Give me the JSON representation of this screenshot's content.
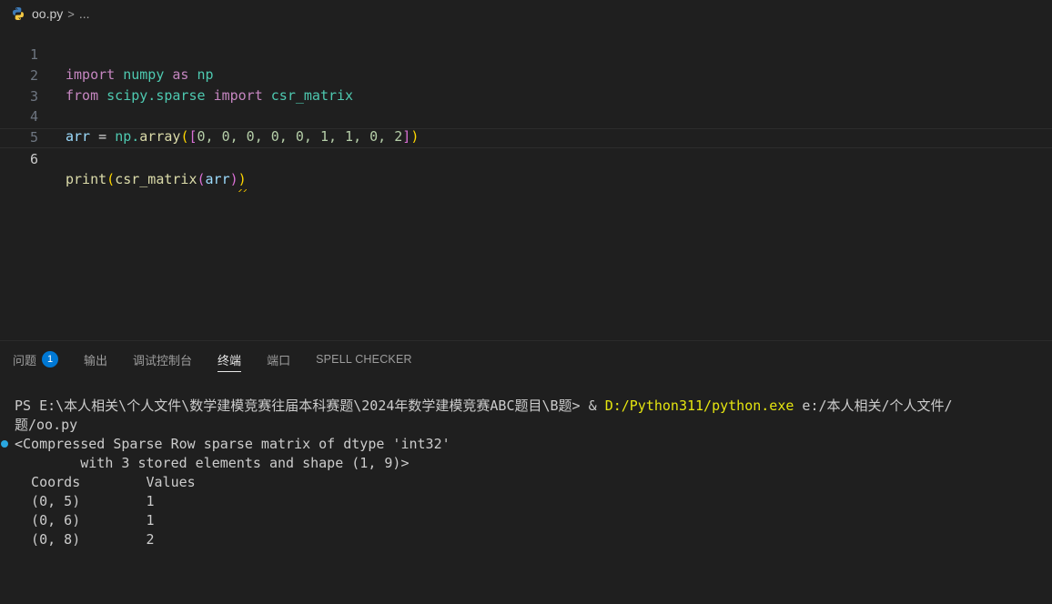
{
  "breadcrumb": {
    "file": "oo.py",
    "separator": ">",
    "more": "..."
  },
  "editor": {
    "line_numbers": [
      "1",
      "2",
      "3",
      "4",
      "5",
      "6"
    ],
    "current_line": "6",
    "tokens": {
      "import": "import",
      "numpy": "numpy",
      "as": "as",
      "np": "np",
      "from": "from",
      "scipy_sparse": "scipy.sparse",
      "csr_matrix": "csr_matrix",
      "arr": "arr",
      "eq": " = ",
      "np_dot": "np.",
      "array": "array",
      "open_paren": "(",
      "open_bracket": "[",
      "array_values": "0, 0, 0, 0, 0, 1, 1, 0, 2",
      "close_bracket": "]",
      "close_paren": ")",
      "print": "print"
    }
  },
  "panel": {
    "tabs": [
      {
        "label": "问题",
        "badge": "1"
      },
      {
        "label": "输出"
      },
      {
        "label": "调试控制台"
      },
      {
        "label": "终端",
        "active": true
      },
      {
        "label": "端口"
      },
      {
        "label": "SPELL CHECKER"
      }
    ]
  },
  "terminal": {
    "prompt": "PS E:\\本人相关\\个人文件\\数学建模竞赛往届本科赛题\\2024年数学建模竞赛ABC题目\\B题> ",
    "amp": "& ",
    "exe": "D:/Python311/python.exe",
    "arg": " e:/本人相关/个人文件/",
    "arg_cont": "题/oo.py",
    "output": [
      "<Compressed Sparse Row sparse matrix of dtype 'int32'",
      "        with 3 stored elements and shape (1, 9)>",
      "  Coords        Values",
      "  (0, 5)        1",
      "  (0, 6)        1",
      "  (0, 8)        2"
    ]
  },
  "colors": {
    "background": "#1f1f1f",
    "keyword": "#c586c0",
    "module": "#4ec9b0",
    "identifier": "#9cdcfe",
    "function": "#dcdcaa",
    "number": "#b5cea8",
    "accent_badge": "#0078d4",
    "terminal_exe": "#e5e510"
  },
  "icons": {
    "file": "python-icon",
    "separator": "chevron-right-icon"
  }
}
